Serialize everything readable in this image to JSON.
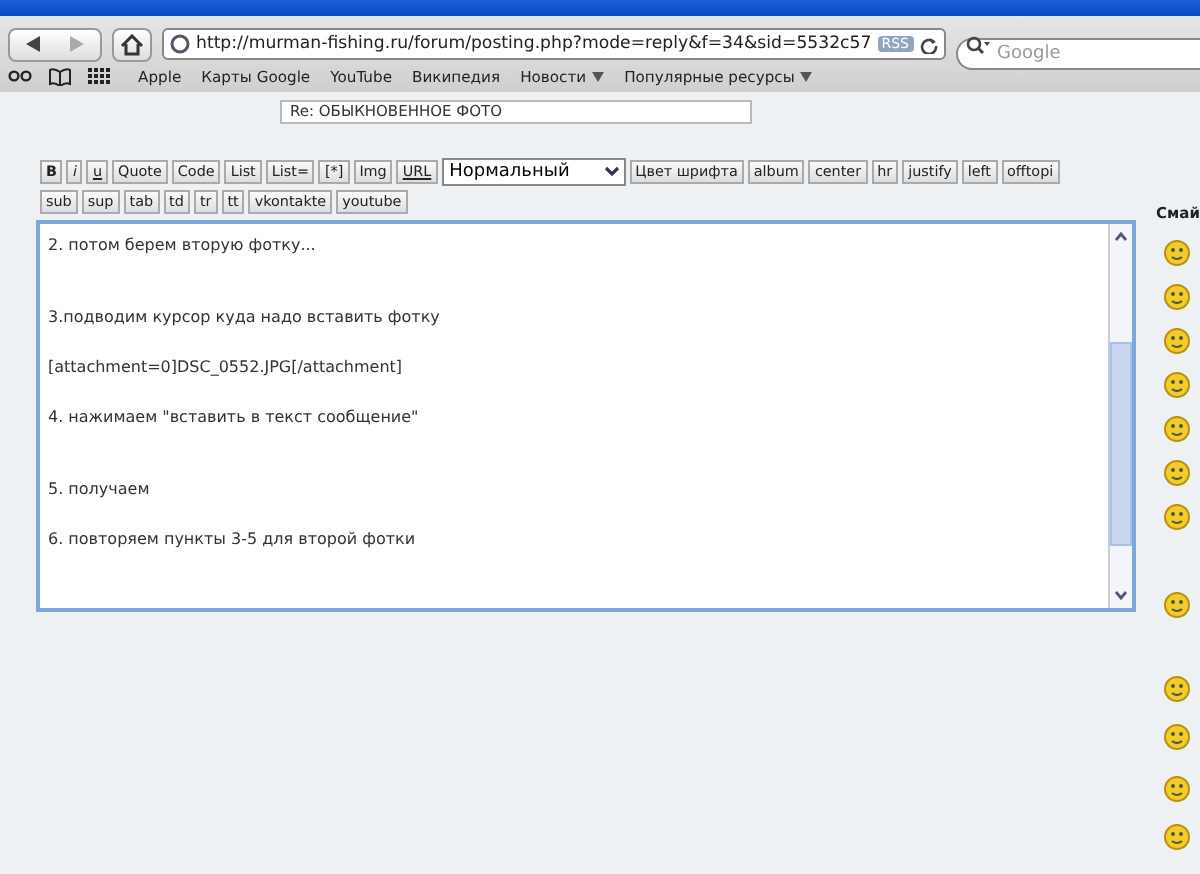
{
  "browser": {
    "url": "http://murman-fishing.ru/forum/posting.php?mode=reply&f=34&sid=5532c57",
    "rss": "RSS",
    "search_placeholder": "Google",
    "bookmarks": [
      {
        "label": "Apple",
        "kind": "link"
      },
      {
        "label": "Карты Google",
        "kind": "link"
      },
      {
        "label": "YouTube",
        "kind": "link"
      },
      {
        "label": "Википедия",
        "kind": "link"
      },
      {
        "label": "Новости",
        "kind": "menu"
      },
      {
        "label": "Популярные ресурсы",
        "kind": "menu"
      }
    ]
  },
  "subject": {
    "value": "Re: ОБЫКНОВЕННОЕ ФОТО"
  },
  "toolbar_rows": [
    [
      "B",
      "i",
      "u",
      "Quote",
      "Code",
      "List",
      "List=",
      "[*]",
      "Img",
      "URL",
      {
        "select": "Нормальный"
      },
      "Цвет шрифта",
      "album",
      "center",
      "hr",
      "justify",
      "left",
      "offtopi"
    ],
    [
      "sub",
      "sup",
      "tab",
      "td",
      "tr",
      "tt",
      "vkontakte",
      "youtube"
    ]
  ],
  "message_lines": [
    {
      "text": "2. потом берем вторую фотку...",
      "kind": "first"
    },
    {
      "text": "3.подводим курсор куда надо вставить фотку",
      "kind": "wide_gap"
    },
    {
      "text": "[attachment=0]DSC_0552.JPG[/attachment]",
      "kind": "gap"
    },
    {
      "text": "4. нажимаем \"вставить в текст сообщение\"",
      "kind": "gap"
    },
    {
      "text": "5. получаем",
      "kind": "wide_gap"
    },
    {
      "text": "6. повторяем пункты 3-5 для второй фотки",
      "kind": "gap"
    }
  ],
  "smilies": {
    "heading": "Смай"
  }
}
